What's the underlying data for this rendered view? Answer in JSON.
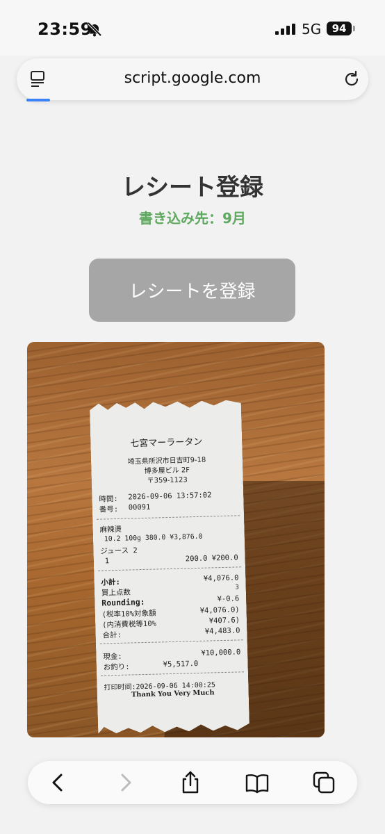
{
  "status_bar": {
    "time": "23:59",
    "network": "5G",
    "battery": "94",
    "icons": [
      "bell-slash-icon",
      "signal-icon"
    ]
  },
  "browser": {
    "url": "script.google.com",
    "icons": [
      "tab-overview-icon",
      "reload-icon"
    ]
  },
  "page": {
    "title": "レシート登録",
    "subtitle": "書き込み先：9月",
    "register_button": "レシートを登録",
    "colors": {
      "subtitle": "#5fa85f",
      "button_bg": "#a6a6a6"
    }
  },
  "receipt": {
    "shop": "七宮マーラータン",
    "address": [
      "埼玉県所沢市日吉町9-18",
      "博多屋ビル 2F",
      "〒359-1123"
    ],
    "time_label": "時間:",
    "time_value": "2026-09-06 13:57:02",
    "number_label": "番号:",
    "number_value": "00091",
    "item1_name": "麻辣燙",
    "item1_detail": "10.2   100g   380.0  ¥3,876.0",
    "item2_name": "ジュース 2",
    "item2_qty": "1",
    "item2_price": "200.0   ¥200.0",
    "subtotal_label": "小計:",
    "subtotal_value": "¥4,076.0",
    "count_label": "買上点数",
    "count_value": "3",
    "rounding_label": "Rounding:",
    "rounding_value": "¥-0.6",
    "taxable_label": "(税率10%対象額",
    "taxable_value": "¥4,076.0)",
    "tax_label": "(内消費税等10%",
    "tax_value": "¥407.6)",
    "total_label": "合計:",
    "total_value": "¥4,483.0",
    "cash_label": "現金:",
    "cash_value": "¥10,000.0",
    "change_label": "お釣り:",
    "change_value": "¥5,517.0",
    "print_time": "打印时间:2026-09-06 14:00:25",
    "thanks": "Thank You Very Much"
  },
  "toolbar": {
    "icons": [
      "back-icon",
      "forward-icon",
      "share-icon",
      "bookmarks-icon",
      "tabs-icon"
    ]
  }
}
